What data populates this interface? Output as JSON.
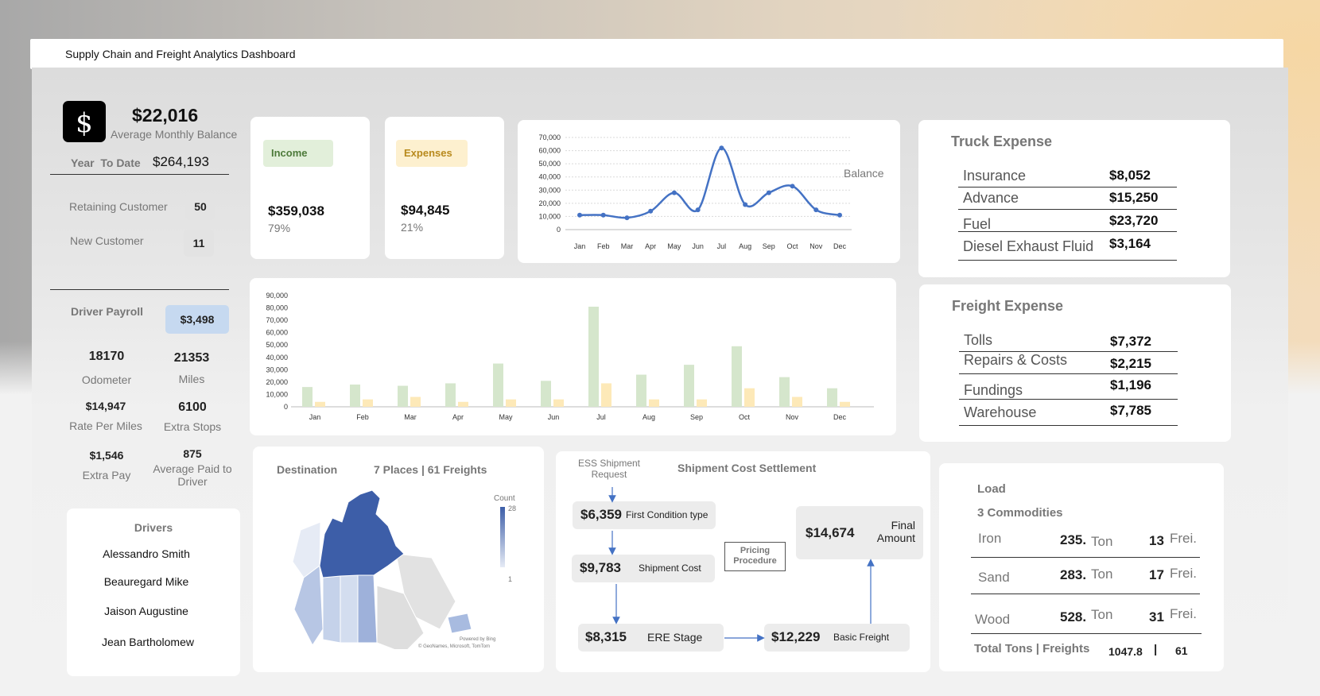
{
  "window": {
    "title": "Supply Chain and Freight Analytics Dashboard"
  },
  "summary": {
    "avg_monthly_balance": "$22,016",
    "avg_monthly_balance_label": "Average Monthly Balance",
    "ytd_label": "Year  To Date",
    "ytd_value": "$264,193",
    "retaining_label": "Retaining Customer",
    "retaining_value": "50",
    "new_label": "New Customer",
    "new_value": "11"
  },
  "driver": {
    "payroll_label": "Driver Payroll",
    "payroll_value": "$3,498",
    "odometer_value": "18170",
    "odometer_label": "Odometer",
    "miles_value": "21353",
    "miles_label": "Miles",
    "rate_value": "$14,947",
    "rate_label": "Rate Per Miles",
    "stops_value": "6100",
    "stops_label": "Extra Stops",
    "extra_pay_value": "$1,546",
    "extra_pay_label": "Extra Pay",
    "avg_paid_value": "875",
    "avg_paid_label": "Average Paid to Driver"
  },
  "drivers": {
    "title": "Drivers",
    "names": [
      "Alessandro Smith",
      "Beauregard Mike",
      "Jaison Augustine",
      "Jean Bartholomew"
    ]
  },
  "income": {
    "label": "Income",
    "value": "$359,038",
    "pct": "79%"
  },
  "expenses": {
    "label": "Expenses",
    "value": "$94,845",
    "pct": "21%"
  },
  "truck_expense": {
    "title": "Truck Expense",
    "rows": [
      {
        "label": "Insurance",
        "value": "$8,052"
      },
      {
        "label": "Advance",
        "value": "$15,250"
      },
      {
        "label": "Fuel",
        "value": "$23,720"
      },
      {
        "label": "Diesel Exhaust Fluid",
        "value": "$3,164"
      }
    ]
  },
  "freight_expense": {
    "title": "Freight Expense",
    "rows": [
      {
        "label": "Tolls",
        "value": "$7,372"
      },
      {
        "label": "Repairs & Costs",
        "value": "$2,215"
      },
      {
        "label": "Fundings",
        "value": "$1,196"
      },
      {
        "label": "Warehouse",
        "value": "$7,785"
      }
    ]
  },
  "destination": {
    "title": "Destination",
    "summary": "7 Places | 61 Freights",
    "legend_title": "Count",
    "legend_max": "28",
    "legend_min": "1",
    "credit_line1": "Powered by Bing",
    "credit_line2": "© GeoNames, Microsoft, TomTom"
  },
  "shipment": {
    "ess_label": "ESS Shipment Request",
    "title": "Shipment Cost Settlement",
    "first_value": "$6,359",
    "first_label": "First Condition type",
    "cost_value": "$9,783",
    "cost_label": "Shipment Cost",
    "ere_value": "$8,315",
    "ere_label": "ERE Stage",
    "basic_value": "$12,229",
    "basic_label": "Basic Freight",
    "final_value": "$14,674",
    "final_label": "Final Amount",
    "pricing_label": "Pricing Procedure"
  },
  "load": {
    "title": "Load",
    "subtitle": "3 Commodities",
    "rows": [
      {
        "name": "Iron",
        "tons": "235.",
        "ton_unit": "Ton",
        "freights": "13",
        "frei_unit": "Frei."
      },
      {
        "name": "Sand",
        "tons": "283.",
        "ton_unit": "Ton",
        "freights": "17",
        "frei_unit": "Frei."
      },
      {
        "name": "Wood",
        "tons": "528.",
        "ton_unit": "Ton",
        "freights": "31",
        "frei_unit": "Frei."
      }
    ],
    "total_label": "Total Tons | Freights",
    "total_tons": "1047.8",
    "total_sep": "|",
    "total_freights": "61"
  },
  "colors": {
    "line": "#4472c4",
    "income_bar": "#d5e6cc",
    "expense_bar": "#fde9b8",
    "income_badge": "#e2efda",
    "expense_badge": "#fdf0cf",
    "payroll_badge": "#c6d9f0",
    "map_dark": "#3d5ea8",
    "map_light": "#d6dff0"
  },
  "chart_data": [
    {
      "type": "line",
      "series_label": "Balance",
      "categories": [
        "Jan",
        "Feb",
        "Mar",
        "Apr",
        "May",
        "Jun",
        "Jul",
        "Aug",
        "Sep",
        "Oct",
        "Nov",
        "Dec"
      ],
      "values": [
        11000,
        11000,
        9000,
        14000,
        28000,
        15000,
        62000,
        19000,
        28000,
        33000,
        15000,
        11000
      ],
      "yticks": [
        "70,000",
        "60,000",
        "50,000",
        "40,000",
        "30,000",
        "20,000",
        "10,000",
        "0"
      ],
      "ylim": [
        0,
        70000
      ],
      "grid": true
    },
    {
      "type": "bar",
      "categories": [
        "Jan",
        "Feb",
        "Mar",
        "Apr",
        "May",
        "Jun",
        "Jul",
        "Aug",
        "Sep",
        "Oct",
        "Nov",
        "Dec"
      ],
      "series": [
        {
          "values": [
            16000,
            18000,
            17000,
            19000,
            35000,
            21000,
            81000,
            26000,
            34000,
            49000,
            24000,
            15000
          ]
        },
        {
          "values": [
            4000,
            6000,
            8000,
            4000,
            6000,
            6000,
            19000,
            6000,
            6000,
            15000,
            8000,
            4000
          ]
        }
      ],
      "yticks": [
        "90,000",
        "80,000",
        "70,000",
        "60,000",
        "50,000",
        "40,000",
        "30,000",
        "20,000",
        "10,000",
        "0"
      ],
      "ylim": [
        0,
        90000
      ],
      "grid": false
    }
  ]
}
